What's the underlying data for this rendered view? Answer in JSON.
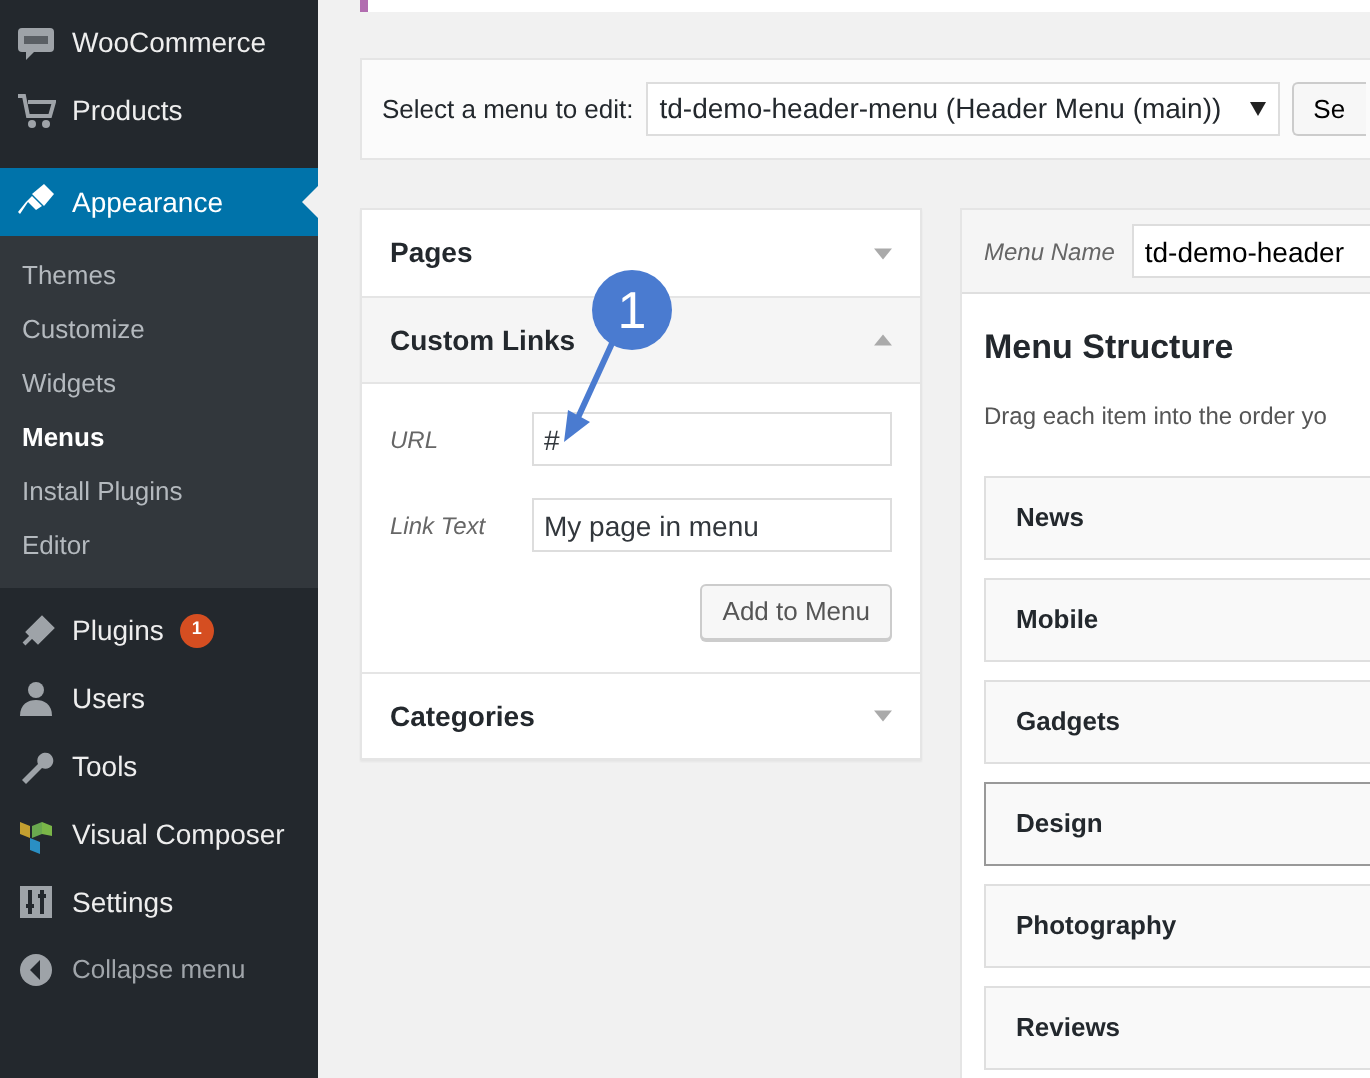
{
  "sidebar": {
    "items": [
      {
        "label": "WooCommerce",
        "current": false
      },
      {
        "label": "Products",
        "current": false
      },
      {
        "label": "Appearance",
        "current": true,
        "children": [
          {
            "label": "Themes",
            "selected": false
          },
          {
            "label": "Customize",
            "selected": false
          },
          {
            "label": "Widgets",
            "selected": false
          },
          {
            "label": "Menus",
            "selected": true
          },
          {
            "label": "Install Plugins",
            "selected": false
          },
          {
            "label": "Editor",
            "selected": false
          }
        ]
      },
      {
        "label": "Plugins",
        "current": false,
        "badge": "1"
      },
      {
        "label": "Users",
        "current": false
      },
      {
        "label": "Tools",
        "current": false
      },
      {
        "label": "Visual Composer",
        "current": false
      },
      {
        "label": "Settings",
        "current": false
      }
    ],
    "collapse": "Collapse menu"
  },
  "menu_select": {
    "label": "Select a menu to edit:",
    "value": "td-demo-header-menu (Header Menu (main))",
    "button": "Se"
  },
  "left_panels": [
    {
      "title": "Pages",
      "expanded": false
    },
    {
      "title": "Custom Links",
      "expanded": true,
      "fields": [
        {
          "label": "URL",
          "value": "#"
        },
        {
          "label": "Link Text",
          "value": "My page in menu"
        }
      ],
      "button": "Add to Menu"
    },
    {
      "title": "Categories",
      "expanded": false
    }
  ],
  "menu_editor": {
    "name_label": "Menu Name",
    "name_value": "td-demo-header",
    "title": "Menu Structure",
    "hint": "Drag each item into the order yo",
    "items": [
      {
        "label": "News",
        "highlighted": false
      },
      {
        "label": "Mobile",
        "highlighted": false
      },
      {
        "label": "Gadgets",
        "highlighted": false
      },
      {
        "label": "Design",
        "highlighted": true
      },
      {
        "label": "Photography",
        "highlighted": false
      },
      {
        "label": "Reviews",
        "highlighted": false
      }
    ]
  },
  "annotation": {
    "label": "1"
  }
}
